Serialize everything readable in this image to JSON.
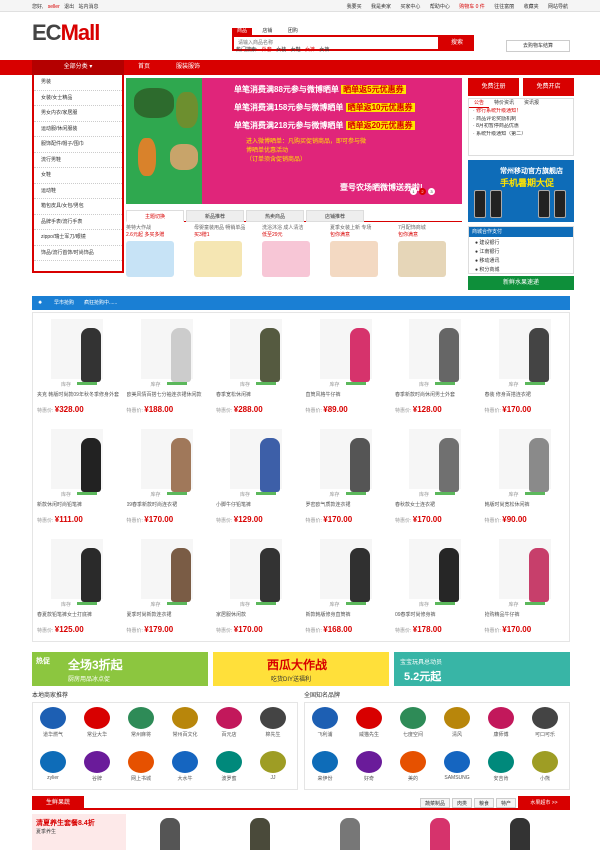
{
  "topbar": {
    "left": [
      "您好,",
      "seller",
      "退出",
      "站内消息"
    ],
    "right": [
      "我要买",
      "我是卖家",
      "买家中心",
      "帮助中心",
      "购物车 0 件",
      "往往富丽",
      "收藏夹",
      "网站导航"
    ]
  },
  "header": {
    "logo_a": "EC",
    "logo_b": "Mall",
    "search_tabs": [
      "商品",
      "店铺",
      "团购"
    ],
    "search_placeholder": "请输入商品名称",
    "search_button": "搜索",
    "hot_label": "热门搜索:",
    "hot_words": [
      "外套",
      "女装",
      "女鞋",
      "女裤",
      "女裤"
    ],
    "cart_label": "去购物车结算"
  },
  "nav": {
    "all_label": "全部分类",
    "items": [
      "首页",
      "服装服饰"
    ]
  },
  "categories": [
    "男装",
    "女装/女士精品",
    "男女内衣/家居服",
    "运动服/休闲服装",
    "服饰配件/帽子/围巾",
    "流行男鞋",
    "女鞋",
    "运动鞋",
    "箱包皮具/女包/男包",
    "品牌手表/流行手表",
    "zippo/瑞士军刀/眼镜",
    "饰品/流行首饰/时尚饰品"
  ],
  "banner": {
    "lines": [
      {
        "text": "单笔消费满88元参与微博晒单",
        "tag": "晒单返5元优惠券"
      },
      {
        "text": "单笔消费满158元参与微博晒单",
        "tag": "晒单返10元优惠券"
      },
      {
        "text": "单笔消费满218元参与微博晒单",
        "tag": "晒单返20元优惠券"
      }
    ],
    "sub1": "进入微博晒单：凡购买促销商品，即可参与微",
    "sub2": "博晒单优惠活动",
    "sub3": "（订单须含促销商品）",
    "slogan": "壹号农场晒微博送券啦!",
    "dots": [
      "1",
      "2",
      "3"
    ]
  },
  "product_tabs": [
    "主题切换",
    "新品推荐",
    "热卖商品",
    "店铺推荐"
  ],
  "product_items": [
    {
      "title": "英特大作战",
      "price": "2.6元起 多买多赠"
    },
    {
      "title": "母婴童装用品 畅销单品",
      "price": "买3赠1"
    },
    {
      "title": "洗浴沐浴 成人清洁",
      "price": "低至29元"
    },
    {
      "title": "夏季女装上新 专场",
      "price": "包你满意"
    },
    {
      "title": "7月配饰商城",
      "price": "包你满意"
    }
  ],
  "right_tabs": [
    "免费注册",
    "免费开店"
  ],
  "news": {
    "tabs": [
      "公告",
      "特价资讯",
      "资讯报"
    ],
    "items": [
      "修行系统升级通知！",
      "商品评论奖励机制",
      "8月初暂停商品优惠",
      "系统升级通知（第二）"
    ]
  },
  "phone_ad": {
    "line1": "常州移动官方旗舰店",
    "line2": "手机暑期大促"
  },
  "partners": {
    "title": "商城合作支付",
    "items": [
      "建设银行",
      "江南银行",
      "移动通讯",
      "积分商城"
    ]
  },
  "fruit_button": "新鲜水果速递",
  "flash": {
    "title": "早市抢购",
    "sub": "疯狂抢购中......"
  },
  "products": [
    {
      "name": "夹克 韩版时尚款09年秋冬季修身外套",
      "price": "¥328.00",
      "color": "#333333"
    },
    {
      "name": "欧美风情百搭七分袖连衣裙休闲款",
      "price": "¥188.00",
      "color": "#cccccc"
    },
    {
      "name": "春季宽松休闲裤",
      "price": "¥288.00",
      "color": "#555a40"
    },
    {
      "name": "直筒风格牛仔裤",
      "price": "¥89.00",
      "color": "#d6336c"
    },
    {
      "name": "春季新款时尚休闲男士外套",
      "price": "¥128.00",
      "color": "#666666"
    },
    {
      "name": "春装 修身百搭连衣裙",
      "price": "¥170.00",
      "color": "#444444"
    },
    {
      "name": "新款休闲时尚铅笔裤",
      "price": "¥111.00",
      "color": "#222222"
    },
    {
      "name": "09春季新款时尚连衣裙",
      "price": "¥170.00",
      "color": "#a0785a"
    },
    {
      "name": "小脚牛仔铅笔裤",
      "price": "¥129.00",
      "color": "#3d5fa8"
    },
    {
      "name": "罗密欧气质款连衣裙",
      "price": "¥170.00",
      "color": "#555555"
    },
    {
      "name": "春秋款女士连衣裙",
      "price": "¥170.00",
      "color": "#707070"
    },
    {
      "name": "韩版时尚宽松休闲裤",
      "price": "¥90.00",
      "color": "#8a8a8a"
    },
    {
      "name": "春夏款铅笔裤女士打底裤",
      "price": "¥125.00",
      "color": "#2a2a2a"
    },
    {
      "name": "夏季时尚新款连衣裙",
      "price": "¥179.00",
      "color": "#7a5c45"
    },
    {
      "name": "家居服休闲款",
      "price": "¥170.00",
      "color": "#333333"
    },
    {
      "name": "新款韩版修身直筒裤",
      "price": "¥168.00",
      "color": "#303030"
    },
    {
      "name": "09春季时尚修身裤",
      "price": "¥178.00",
      "color": "#262626"
    },
    {
      "name": "抢购精品牛仔裤",
      "price": "¥170.00",
      "color": "#c73f6b"
    }
  ],
  "stock_label": "库存",
  "price_prefix": "特惠价:",
  "ads": [
    {
      "big": "全场3折起",
      "small": "厨房用品冰点促",
      "tag": "热促"
    },
    {
      "big": "西瓜大作战",
      "small": "吃货DIY送福利",
      "tag": ""
    },
    {
      "big": "5.2元起",
      "small": "宝宝玩具总动员",
      "tag": ""
    }
  ],
  "local_brands": {
    "title": "本地商家推荐",
    "items": [
      "道华燃气",
      "常业大华",
      "常州麻将",
      "常州百文化",
      "百元店",
      "棉先生",
      "zylier",
      "谷牌",
      "网上书城",
      "大水牛",
      "波罗蜜",
      "JJ"
    ]
  },
  "national_brands": {
    "title": "全国知名品牌",
    "items": [
      "飞利浦",
      "威猫先生",
      "七度空间",
      "清风",
      "康师傅",
      "可口可乐",
      "来伊份",
      "好奇",
      "美的",
      "SAMSUNG",
      "安吉肯",
      "小熊"
    ]
  },
  "fresh": {
    "title": "生鲜果蔬",
    "tabs": [
      "蔬菜制品",
      "肉类",
      "粮食",
      "特产"
    ],
    "more": "水果超市 >>",
    "promo_a": "清夏养生套餐8.4折",
    "promo_b": "夏季养生"
  }
}
